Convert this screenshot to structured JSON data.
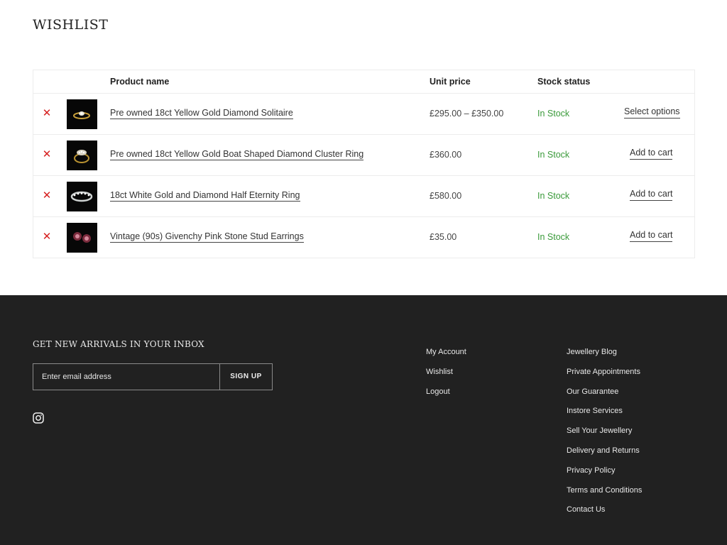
{
  "page": {
    "title": "WISHLIST"
  },
  "table": {
    "headers": {
      "product_name": "Product name",
      "unit_price": "Unit price",
      "stock_status": "Stock status"
    },
    "rows": [
      {
        "name": "Pre owned 18ct Yellow Gold Diamond Solitaire",
        "price": "£295.00 – £350.00",
        "stock": "In Stock",
        "action": "Select options",
        "image": "ring-icon"
      },
      {
        "name": "Pre owned 18ct Yellow Gold Boat Shaped Diamond Cluster Ring",
        "price": "£360.00",
        "stock": "In Stock",
        "action": "Add to cart",
        "image": "cluster-ring-icon"
      },
      {
        "name": "18ct White Gold and Diamond Half Eternity Ring",
        "price": "£580.00",
        "stock": "In Stock",
        "action": "Add to cart",
        "image": "eternity-ring-icon"
      },
      {
        "name": "Vintage (90s) Givenchy Pink Stone Stud Earrings",
        "price": "£35.00",
        "stock": "In Stock",
        "action": "Add to cart",
        "image": "earrings-icon"
      }
    ],
    "remove_icon": "close-icon",
    "colors": {
      "remove": "#d62020",
      "in_stock": "#3a9a3a"
    }
  },
  "footer": {
    "newsletter_heading": "GET NEW ARRIVALS IN YOUR INBOX",
    "email_placeholder": "Enter email address",
    "signup_label": "SIGN UP",
    "social_icon": "instagram-icon",
    "account_links": [
      "My Account",
      "Wishlist",
      "Logout"
    ],
    "info_links": [
      "Jewellery Blog",
      "Private Appointments",
      "Our Guarantee",
      "Instore Services",
      "Sell Your Jewellery",
      "Delivery and Returns",
      "Privacy Policy",
      "Terms and Conditions",
      "Contact Us"
    ],
    "colors": {
      "background": "#212121"
    }
  }
}
